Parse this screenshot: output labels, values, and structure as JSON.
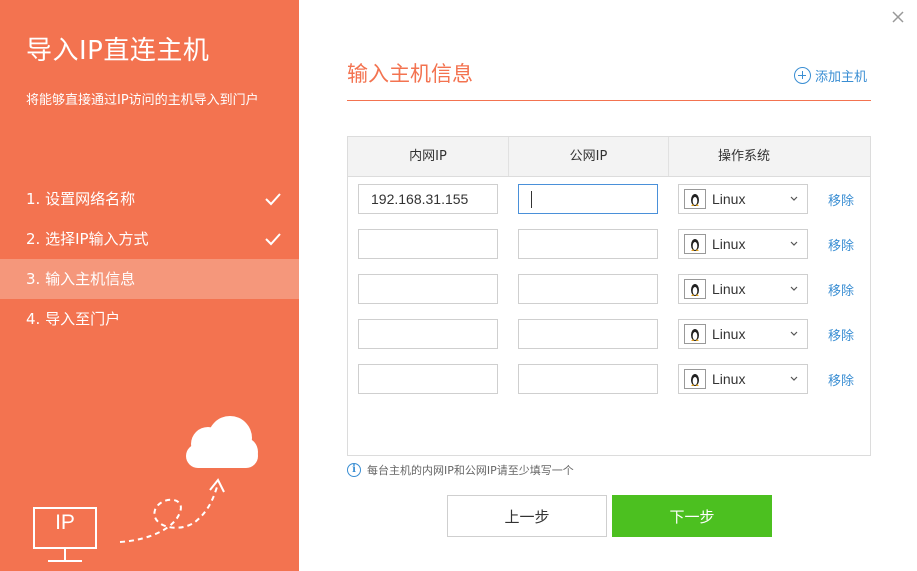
{
  "sidebar": {
    "title": "导入IP直连主机",
    "description": "将能够直接通过IP访问的主机导入到门户",
    "steps": [
      {
        "label": "1. 设置网络名称",
        "done": true
      },
      {
        "label": "2. 选择IP输入方式",
        "done": true
      },
      {
        "label": "3. 输入主机信息",
        "active": true
      },
      {
        "label": "4. 导入至门户"
      }
    ],
    "illustration_text": "IP"
  },
  "main": {
    "heading": "输入主机信息",
    "add_host_label": "添加主机",
    "table": {
      "headers": [
        "内网IP",
        "公网IP",
        "操作系统"
      ],
      "rows": [
        {
          "internal_ip": "192.168.31.155",
          "public_ip": "",
          "os": "Linux",
          "remove": "移除"
        },
        {
          "internal_ip": "",
          "public_ip": "",
          "os": "Linux",
          "remove": "移除"
        },
        {
          "internal_ip": "",
          "public_ip": "",
          "os": "Linux",
          "remove": "移除"
        },
        {
          "internal_ip": "",
          "public_ip": "",
          "os": "Linux",
          "remove": "移除"
        },
        {
          "internal_ip": "",
          "public_ip": "",
          "os": "Linux",
          "remove": "移除"
        }
      ]
    },
    "tip": "每台主机的内网IP和公网IP请至少填写一个",
    "prev_label": "上一步",
    "next_label": "下一步"
  },
  "colors": {
    "accent": "#f37350",
    "active_step": "#f5977b",
    "link": "#3a8ed3",
    "primary_button": "#4cc020"
  }
}
